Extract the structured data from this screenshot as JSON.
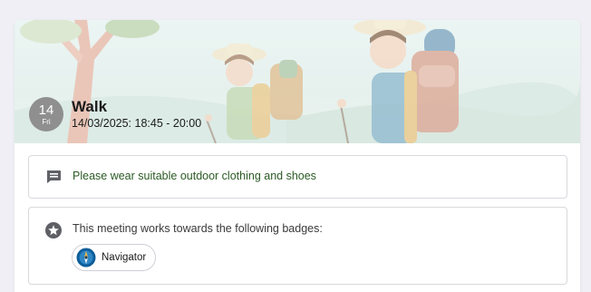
{
  "event": {
    "day": "14",
    "weekday": "Fri",
    "title": "Walk",
    "datetime": "14/03/2025: 18:45 - 20:00"
  },
  "note": {
    "icon": "comment-icon",
    "text": "Please wear suitable outdoor clothing and shoes",
    "color": "#2b5a25"
  },
  "badges": {
    "icon": "star-circle-icon",
    "heading": "This meeting works towards the following badges:",
    "items": [
      {
        "label": "Navigator",
        "icon": "navigator-badge-icon"
      }
    ]
  },
  "colors": {
    "page_background": "#efeff5",
    "date_badge": "#8f8f8f",
    "border": "#d9d9de"
  }
}
